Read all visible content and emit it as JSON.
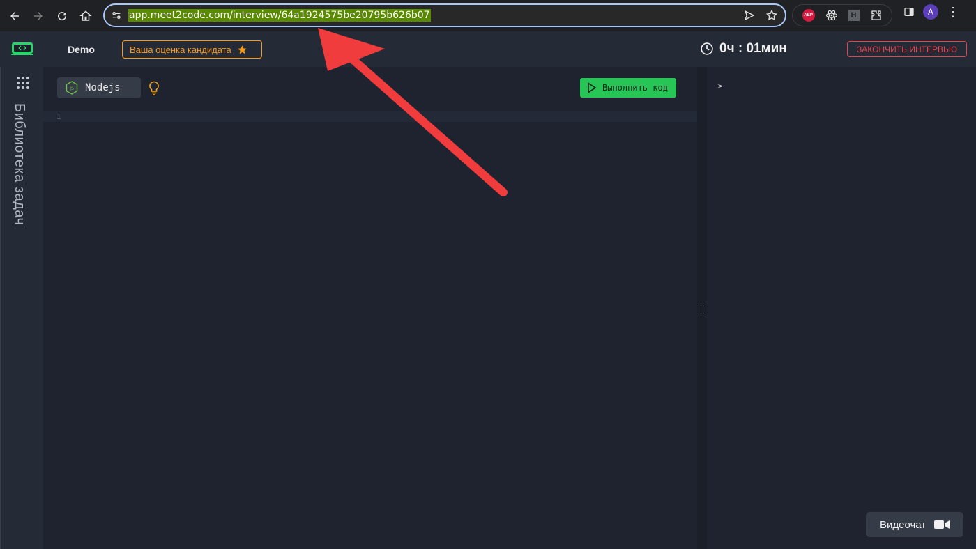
{
  "browser": {
    "url": "app.meet2code.com/interview/64a1924575be20795b626b07",
    "profile_initial": "A",
    "extensions": [
      "ABP",
      "react-devtools",
      "H",
      "extensions"
    ],
    "abp_label": "ABP",
    "h_label": "H"
  },
  "header": {
    "demo_label": "Demo",
    "rating_label": "Ваша оценка кандидата",
    "timer": "0ч : 01мин",
    "end_button": "ЗАКОНЧИТЬ ИНТЕРВЬЮ"
  },
  "sidebar": {
    "library_label": "Библиотека задач"
  },
  "editor": {
    "language": "Nodejs",
    "run_button": "Выполнить код",
    "line_numbers": [
      "1"
    ]
  },
  "console": {
    "prompt": ">"
  },
  "video": {
    "label": "Видеочат"
  },
  "colors": {
    "accent_green": "#27c456",
    "accent_orange": "#f39b1f",
    "danger_red": "#e8424a",
    "annotation_arrow": "#f03c3c"
  }
}
